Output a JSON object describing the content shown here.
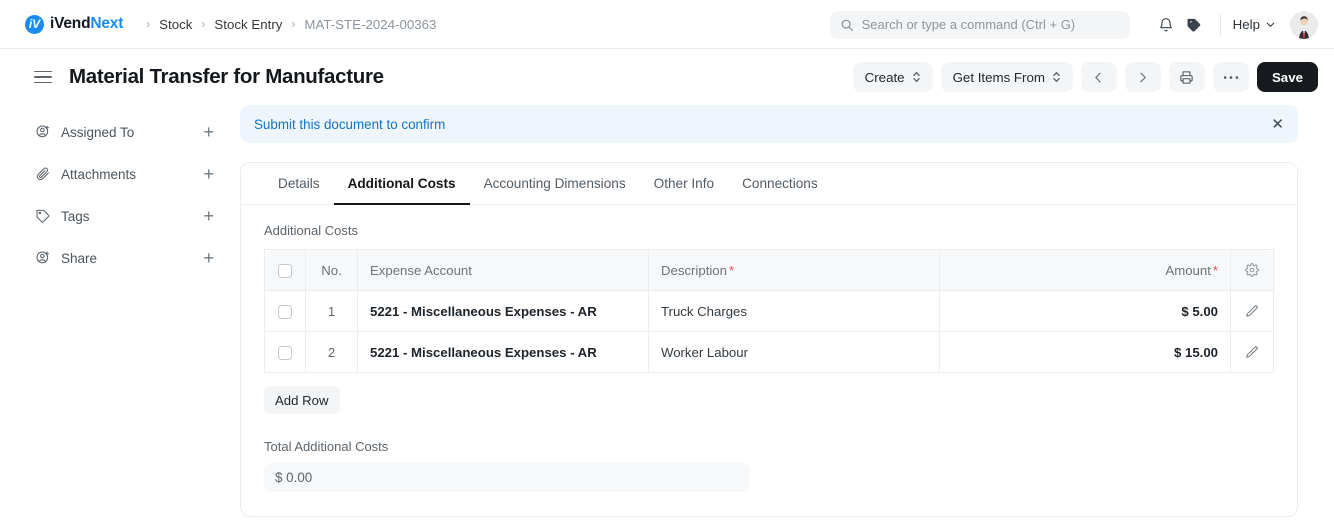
{
  "navbar": {
    "brand": {
      "part1": "iVend",
      "part2": "Next",
      "logo_glyph": "iV"
    },
    "breadcrumbs": [
      {
        "label": "Stock",
        "muted": false
      },
      {
        "label": "Stock Entry",
        "muted": false
      },
      {
        "label": "MAT-STE-2024-00363",
        "muted": true
      }
    ],
    "separator": "›",
    "search": {
      "placeholder": "Search or type a command (Ctrl + G)",
      "value": "",
      "icon": "search-icon"
    },
    "notifications_icon": "bell-icon",
    "tag_icon": "tag-icon",
    "help": {
      "label": "Help",
      "chevron": "chevron-down-icon"
    },
    "avatar": "user-avatar"
  },
  "titlebar": {
    "menu_icon": "hamburger-icon",
    "title": "Material Transfer for Manufacture",
    "buttons": {
      "create": "Create",
      "get_items_from": "Get Items From",
      "prev": "‹",
      "next": "›",
      "print_icon": "printer-icon",
      "more_icon": "ellipsis-icon",
      "save": "Save"
    }
  },
  "sidebar": {
    "items": [
      {
        "label": "Assigned To",
        "icon": "user-plus-icon",
        "add": "+"
      },
      {
        "label": "Attachments",
        "icon": "paperclip-icon",
        "add": "+"
      },
      {
        "label": "Tags",
        "icon": "tag-icon",
        "add": "+"
      },
      {
        "label": "Share",
        "icon": "user-plus-icon",
        "add": "+"
      }
    ]
  },
  "alert": {
    "message": "Submit this document to confirm",
    "close": "✕",
    "color": "#1573cd",
    "background": "#eef5fd"
  },
  "tabs": [
    {
      "label": "Details",
      "active": false
    },
    {
      "label": "Additional Costs",
      "active": true
    },
    {
      "label": "Accounting Dimensions",
      "active": false
    },
    {
      "label": "Other Info",
      "active": false
    },
    {
      "label": "Connections",
      "active": false
    }
  ],
  "section": {
    "heading": "Additional Costs",
    "table": {
      "columns": [
        {
          "key": "check",
          "label": ""
        },
        {
          "key": "no",
          "label": "No."
        },
        {
          "key": "expense_account",
          "label": "Expense Account"
        },
        {
          "key": "description",
          "label": "Description",
          "required": true
        },
        {
          "key": "amount",
          "label": "Amount",
          "required": true
        },
        {
          "key": "tools",
          "label": "",
          "icon": "gear-icon"
        }
      ],
      "required_marker": "*",
      "rows": [
        {
          "no": "1",
          "expense_account": "5221 - Miscellaneous Expenses - AR",
          "description": "Truck Charges",
          "amount": "$ 5.00",
          "edit_icon": "pencil-icon"
        },
        {
          "no": "2",
          "expense_account": "5221 - Miscellaneous Expenses - AR",
          "description": "Worker Labour",
          "amount": "$ 15.00",
          "edit_icon": "pencil-icon"
        }
      ]
    },
    "add_row": "Add Row",
    "total": {
      "label": "Total Additional Costs",
      "value": "$ 0.00"
    }
  }
}
